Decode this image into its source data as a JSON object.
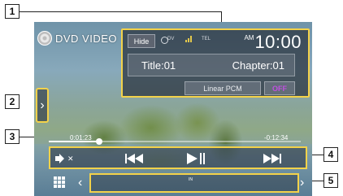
{
  "source": {
    "label": "DVD VIDEO",
    "icon": "disc-icon"
  },
  "info_panel": {
    "hide_label": "Hide",
    "status": {
      "tel_label": "TEL"
    },
    "clock": {
      "ampm": "AM",
      "time": "10:00"
    },
    "title": "Title:01",
    "chapter": "Chapter:01",
    "audio_format": "Linear PCM",
    "off_label": "OFF"
  },
  "playback": {
    "elapsed": "0:01:23",
    "remaining": "-0:12:34",
    "progress_fraction": 0.2
  },
  "controls": [
    "mute-icon",
    "previous-icon",
    "play-pause-icon",
    "next-icon"
  ],
  "function_bar": {
    "label": "IN"
  },
  "callouts": [
    "1",
    "2",
    "3",
    "4",
    "5"
  ],
  "colors": {
    "highlight": "#f3d24a",
    "off_accent": "#c050e0",
    "panel": "#283040"
  }
}
